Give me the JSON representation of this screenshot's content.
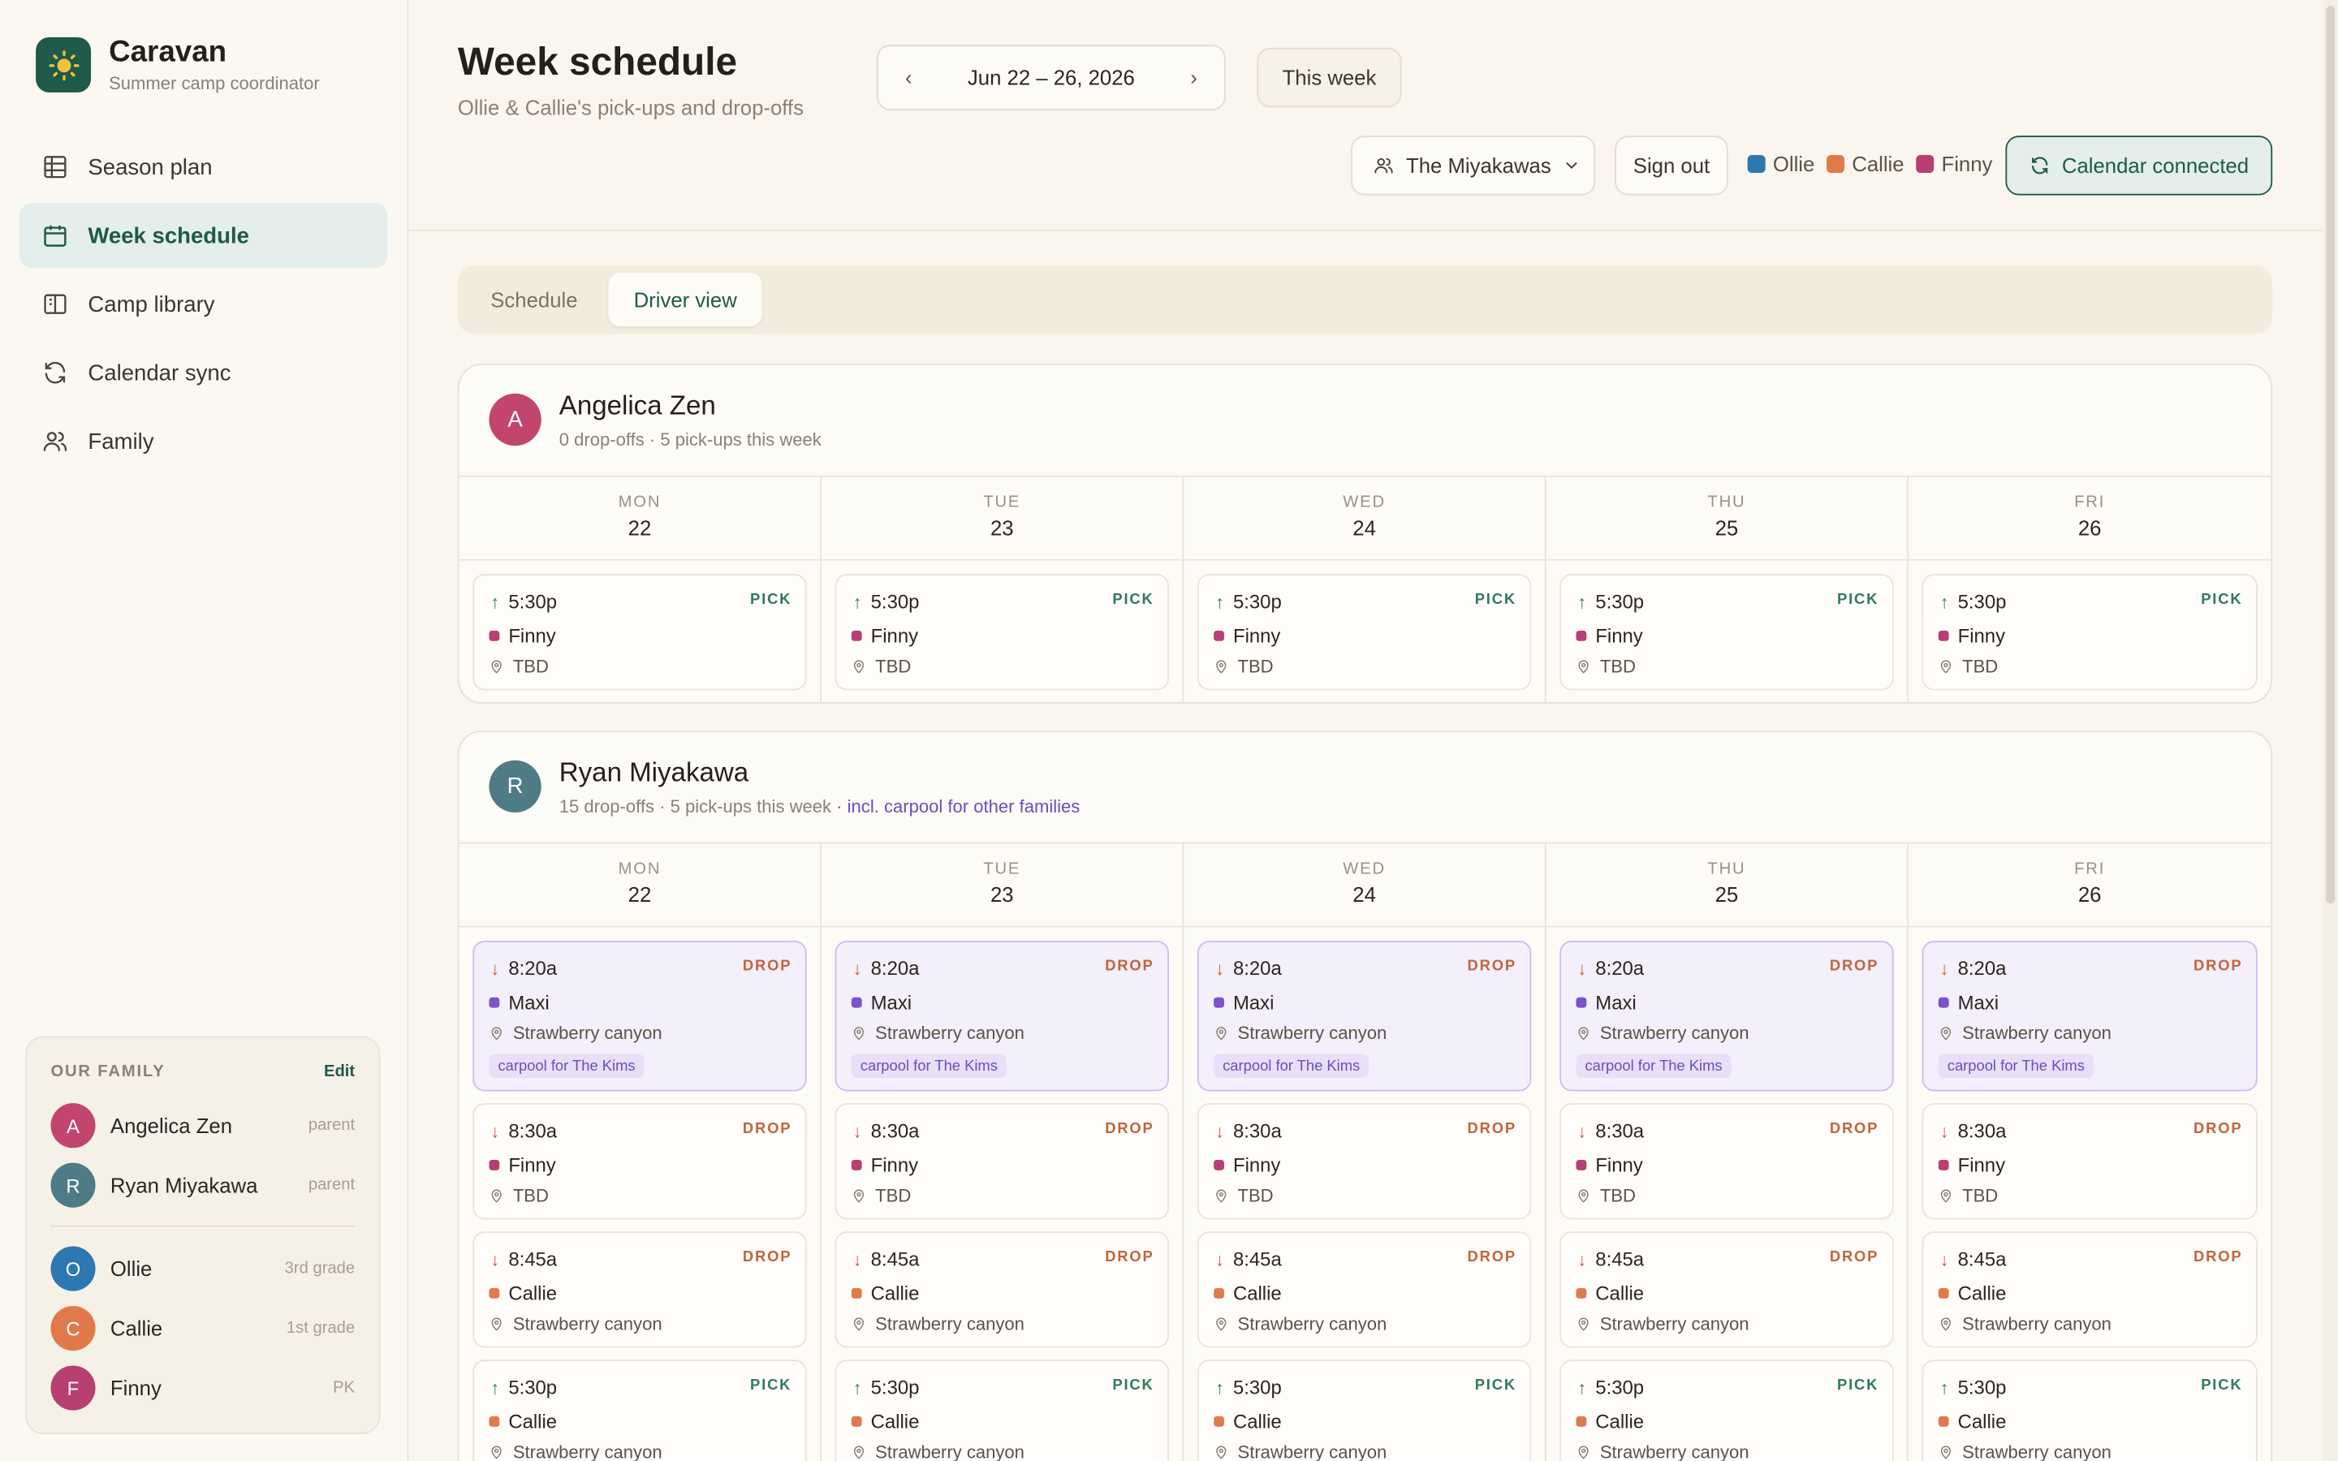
{
  "app": {
    "name": "Caravan",
    "tagline": "Summer camp coordinator"
  },
  "sidebar": {
    "items": [
      {
        "label": "Season plan",
        "icon": "grid-icon"
      },
      {
        "label": "Week schedule",
        "icon": "calendar-icon",
        "active": true
      },
      {
        "label": "Camp library",
        "icon": "book-icon"
      },
      {
        "label": "Calendar sync",
        "icon": "sync-icon"
      },
      {
        "label": "Family",
        "icon": "users-icon"
      }
    ],
    "family": {
      "title": "OUR FAMILY",
      "edit_label": "Edit",
      "members": [
        {
          "initial": "A",
          "name": "Angelica Zen",
          "role": "parent",
          "color": "#c2456e"
        },
        {
          "initial": "R",
          "name": "Ryan Miyakawa",
          "role": "parent",
          "color": "#4f7b87"
        },
        {
          "initial": "O",
          "name": "Ollie",
          "role": "3rd grade",
          "color": "#2d78b0"
        },
        {
          "initial": "C",
          "name": "Callie",
          "role": "1st grade",
          "color": "#e07a4a"
        },
        {
          "initial": "F",
          "name": "Finny",
          "role": "PK",
          "color": "#b83f72"
        }
      ]
    }
  },
  "header": {
    "title": "Week schedule",
    "subtitle": "Ollie & Callie's pick-ups and drop-offs",
    "week_label": "Jun 22 – 26, 2026",
    "prev": "‹",
    "next": "›",
    "this_week": "This week",
    "household": "The Miyakawas",
    "sign_out": "Sign out",
    "legend": [
      {
        "name": "Ollie",
        "color": "#2d78b0"
      },
      {
        "name": "Callie",
        "color": "#e07a4a"
      },
      {
        "name": "Finny",
        "color": "#b83f72"
      }
    ],
    "calendar_button": "Calendar connected"
  },
  "tabs": [
    {
      "label": "Schedule",
      "active": false
    },
    {
      "label": "Driver view",
      "active": true
    }
  ],
  "days": [
    {
      "dow": "MON",
      "num": "22"
    },
    {
      "dow": "TUE",
      "num": "23"
    },
    {
      "dow": "WED",
      "num": "24"
    },
    {
      "dow": "THU",
      "num": "25"
    },
    {
      "dow": "FRI",
      "num": "26"
    }
  ],
  "kid_colors": {
    "Finny": "#b83f72",
    "Callie": "#e07a4a",
    "Maxi": "#7b52c9"
  },
  "drivers": [
    {
      "initial": "A",
      "name": "Angelica Zen",
      "color": "#c2456e",
      "summary": "0 drop-offs · 5 pick-ups this week",
      "note": "",
      "events": [
        {
          "time": "5:30p",
          "kind": "PICK",
          "kid": "Finny",
          "location": "TBD",
          "carpool": ""
        }
      ]
    },
    {
      "initial": "R",
      "name": "Ryan Miyakawa",
      "color": "#4f7b87",
      "summary": "15 drop-offs · 5 pick-ups this week",
      "note": "· incl. carpool for other families",
      "events": [
        {
          "time": "8:20a",
          "kind": "DROP",
          "kid": "Maxi",
          "location": "Strawberry canyon",
          "carpool": "carpool for The Kims"
        },
        {
          "time": "8:30a",
          "kind": "DROP",
          "kid": "Finny",
          "location": "TBD",
          "carpool": ""
        },
        {
          "time": "8:45a",
          "kind": "DROP",
          "kid": "Callie",
          "location": "Strawberry canyon",
          "carpool": ""
        },
        {
          "time": "5:30p",
          "kind": "PICK",
          "kid": "Callie",
          "location": "Strawberry canyon",
          "carpool": ""
        }
      ]
    }
  ]
}
